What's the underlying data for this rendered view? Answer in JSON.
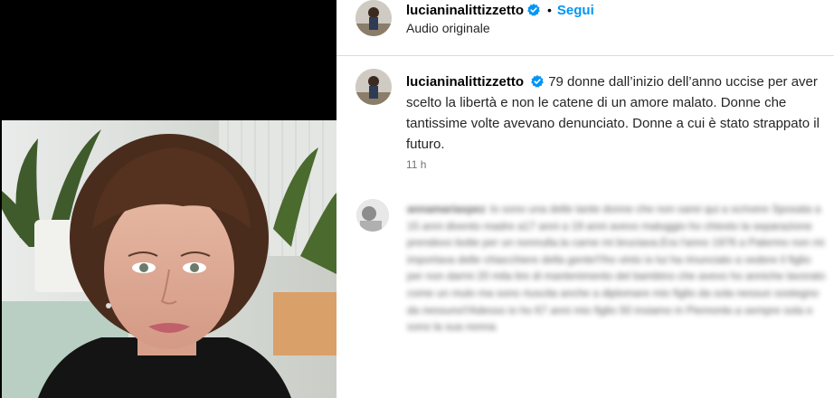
{
  "header": {
    "username": "lucianinalittizzetto",
    "separator": "•",
    "follow_label": "Segui",
    "audio_label": "Audio originale"
  },
  "caption": {
    "username": "lucianinalittizzetto",
    "text": "79 donne dall’inizio dell’anno uccise per aver scelto la libertà e non le catene di un amore malato. Donne che tantissime volte avevano denunciato. Donne a cui è stato strappato il futuro.",
    "time": "11 h"
  },
  "comment": {
    "username": "annamariaxpez",
    "text": "Io sono una delle tante donne che non sarei qui a scrivere Sposata a 15 anni divento madre a17 anni a 19 anni avevo maluggio ho chiesto la separazione prendevo botte per un nonnulla.la carne mi bruciava.Era l'anno 1976 a Palermo non mi importava delle chiacchiere della gente!!!ho vinto io lui ha rinunciato a vedere il figlio per non darmi 20 mila lire di mantenimento del bambino che avevo ho anniche lavorato come un mulo ma sono riuscita anche a diplomare mio figlio da sola nessun sostegno da nessuno!!Adesso io ho 67 anni mio figlio 50 insiamo in Piemonte.a sempre sola e sono la sua nonna"
  },
  "colors": {
    "accent": "#0095f6",
    "verified_badge": "#0095f6",
    "media_background": "#000000",
    "divider": "#dbdbdb"
  },
  "icons": {
    "verified": "verified-badge-icon"
  }
}
